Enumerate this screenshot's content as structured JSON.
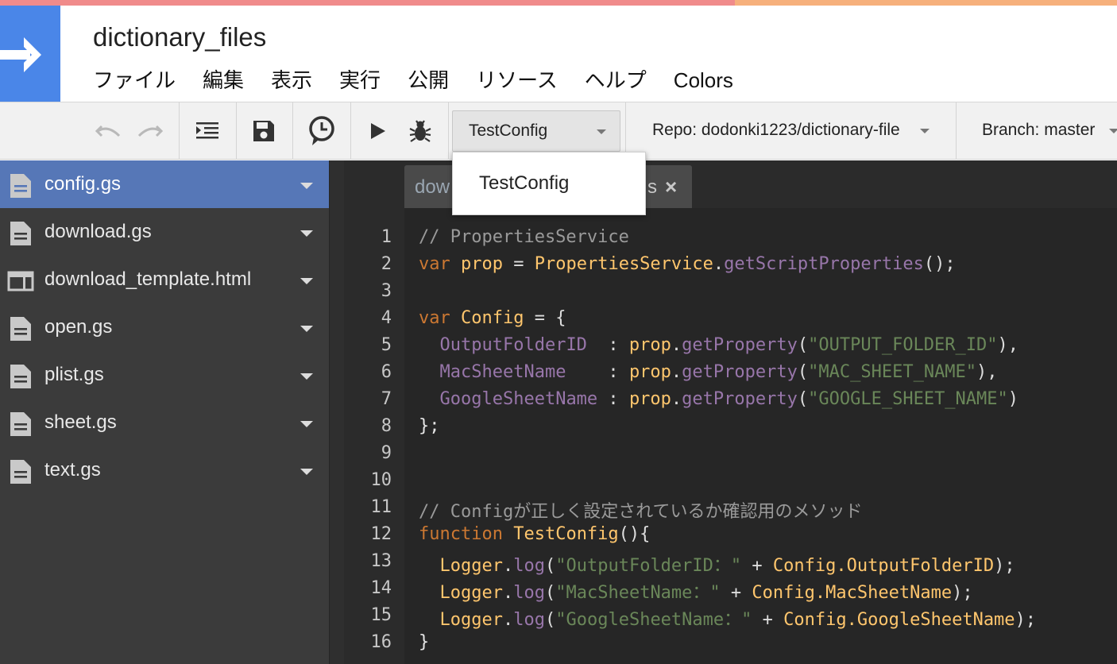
{
  "colors": {
    "logo_blue": "#4a86e8",
    "active_file": "#5677b7",
    "sidebar_bg": "#3b3b3b",
    "editor_bg": "#262626"
  },
  "project": {
    "title": "dictionary_files"
  },
  "menu": [
    "ファイル",
    "編集",
    "表示",
    "実行",
    "公開",
    "リソース",
    "ヘルプ",
    "Colors"
  ],
  "toolbar": {
    "icons": [
      "undo-icon",
      "redo-icon",
      "indent-icon",
      "save-icon",
      "triggers-clock-icon",
      "run-icon",
      "debug-bug-icon"
    ],
    "function_select": "TestConfig",
    "repo": "Repo: dodonki1223/dictionary-file",
    "branch": "Branch: master"
  },
  "function_dropdown": {
    "options": [
      "TestConfig"
    ]
  },
  "files": [
    {
      "name": "config.gs",
      "icon": "script-file-icon",
      "active": true
    },
    {
      "name": "download.gs",
      "icon": "script-file-icon",
      "active": false
    },
    {
      "name": "download_template.html",
      "icon": "html-file-icon",
      "active": false
    },
    {
      "name": "open.gs",
      "icon": "script-file-icon",
      "active": false
    },
    {
      "name": "plist.gs",
      "icon": "script-file-icon",
      "active": false
    },
    {
      "name": "sheet.gs",
      "icon": "script-file-icon",
      "active": false
    },
    {
      "name": "text.gs",
      "icon": "script-file-icon",
      "active": false
    }
  ],
  "editor": {
    "tab_label_visible_start": "dow",
    "tab_label_visible_end": "s",
    "tab_close": "×",
    "line_numbers": [
      "1",
      "2",
      "3",
      "4",
      "5",
      "6",
      "7",
      "8",
      "9",
      "10",
      "11",
      "12",
      "13",
      "14",
      "15",
      "16"
    ],
    "code": {
      "l1": "// PropertiesService",
      "l2": {
        "kw": "var",
        "v": "prop",
        "eq": " = ",
        "obj": "PropertiesService",
        "dot": ".",
        "m": "getScriptProperties",
        "end": "();"
      },
      "l4": {
        "kw": "var",
        "v": "Config",
        "end": " = {"
      },
      "l5": {
        "k": "OutputFolderID",
        "sep": "  : ",
        "o": "prop",
        "dot": ".",
        "m": "getProperty",
        "p1": "(",
        "s": "\"OUTPUT_FOLDER_ID\"",
        "p2": "),"
      },
      "l6": {
        "k": "MacSheetName",
        "sep": "    : ",
        "o": "prop",
        "dot": ".",
        "m": "getProperty",
        "p1": "(",
        "s": "\"MAC_SHEET_NAME\"",
        "p2": "),"
      },
      "l7": {
        "k": "GoogleSheetName",
        "sep": " : ",
        "o": "prop",
        "dot": ".",
        "m": "getProperty",
        "p1": "(",
        "s": "\"GOOGLE_SHEET_NAME\"",
        "p2": ")"
      },
      "l8": "};",
      "l11": "// Configが正しく設定されているか確認用のメソッド",
      "l12": {
        "kw": "function",
        "name": "TestConfig",
        "end": "(){"
      },
      "l13": {
        "o": "Logger",
        "dot": ".",
        "m": "log",
        "p1": "(",
        "s": "\"OutputFolderID：\"",
        "plus": " + ",
        "cfg": "Config.OutputFolderID",
        "end": ");"
      },
      "l14": {
        "o": "Logger",
        "dot": ".",
        "m": "log",
        "p1": "(",
        "s": "\"MacSheetName：\"",
        "plus": " + ",
        "cfg": "Config.MacSheetName",
        "end": ");"
      },
      "l15": {
        "o": "Logger",
        "dot": ".",
        "m": "log",
        "p1": "(",
        "s": "\"GoogleSheetName：\"",
        "plus": " + ",
        "cfg": "Config.GoogleSheetName",
        "end": ");"
      },
      "l16": "}"
    }
  }
}
